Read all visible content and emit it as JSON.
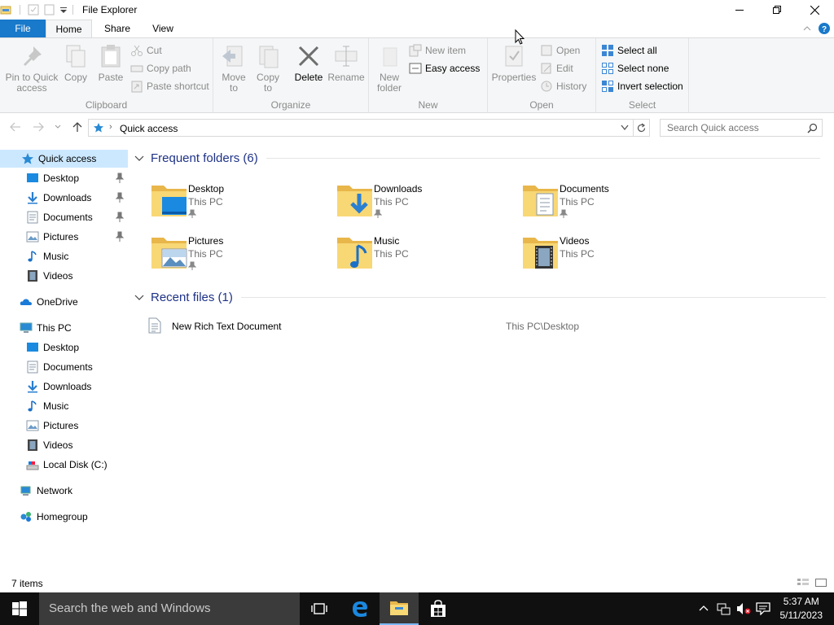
{
  "window": {
    "title": "File Explorer"
  },
  "tabs": [
    "File",
    "Home",
    "Share",
    "View"
  ],
  "ribbon": {
    "clipboard": {
      "label": "Clipboard",
      "pin": "Pin to Quick access",
      "copy": "Copy",
      "paste": "Paste",
      "cut": "Cut",
      "copy_path": "Copy path",
      "paste_shortcut": "Paste shortcut"
    },
    "organize": {
      "label": "Organize",
      "move_to": "Move to",
      "copy_to": "Copy to",
      "delete": "Delete",
      "rename": "Rename"
    },
    "new": {
      "label": "New",
      "new_folder": "New folder",
      "new_item": "New item",
      "easy_access": "Easy access"
    },
    "open": {
      "label": "Open",
      "properties": "Properties",
      "open": "Open",
      "edit": "Edit",
      "history": "History"
    },
    "select": {
      "label": "Select",
      "select_all": "Select all",
      "select_none": "Select none",
      "invert": "Invert selection"
    }
  },
  "address": {
    "path": "Quick access",
    "search_placeholder": "Search Quick access"
  },
  "nav": {
    "quick_access": "Quick access",
    "quick_items": [
      "Desktop",
      "Downloads",
      "Documents",
      "Pictures",
      "Music",
      "Videos"
    ],
    "onedrive": "OneDrive",
    "this_pc": "This PC",
    "pc_items": [
      "Desktop",
      "Documents",
      "Downloads",
      "Music",
      "Pictures",
      "Videos",
      "Local Disk (C:)"
    ],
    "network": "Network",
    "homegroup": "Homegroup"
  },
  "content": {
    "frequent_title": "Frequent folders (6)",
    "folders": [
      {
        "name": "Desktop",
        "location": "This PC",
        "pinned": true
      },
      {
        "name": "Downloads",
        "location": "This PC",
        "pinned": true
      },
      {
        "name": "Documents",
        "location": "This PC",
        "pinned": true
      },
      {
        "name": "Pictures",
        "location": "This PC",
        "pinned": true
      },
      {
        "name": "Music",
        "location": "This PC",
        "pinned": false
      },
      {
        "name": "Videos",
        "location": "This PC",
        "pinned": false
      }
    ],
    "recent_title": "Recent files (1)",
    "recent": [
      {
        "name": "New Rich Text Document",
        "path": "This PC\\Desktop"
      }
    ]
  },
  "status": {
    "items": "7 items"
  },
  "taskbar": {
    "search": "Search the web and Windows",
    "time": "5:37 AM",
    "date": "5/11/2023"
  },
  "colors": {
    "accent": "#1979ca",
    "selection": "#cce8ff",
    "folder": "#f8d775",
    "heading": "#1e3287"
  }
}
